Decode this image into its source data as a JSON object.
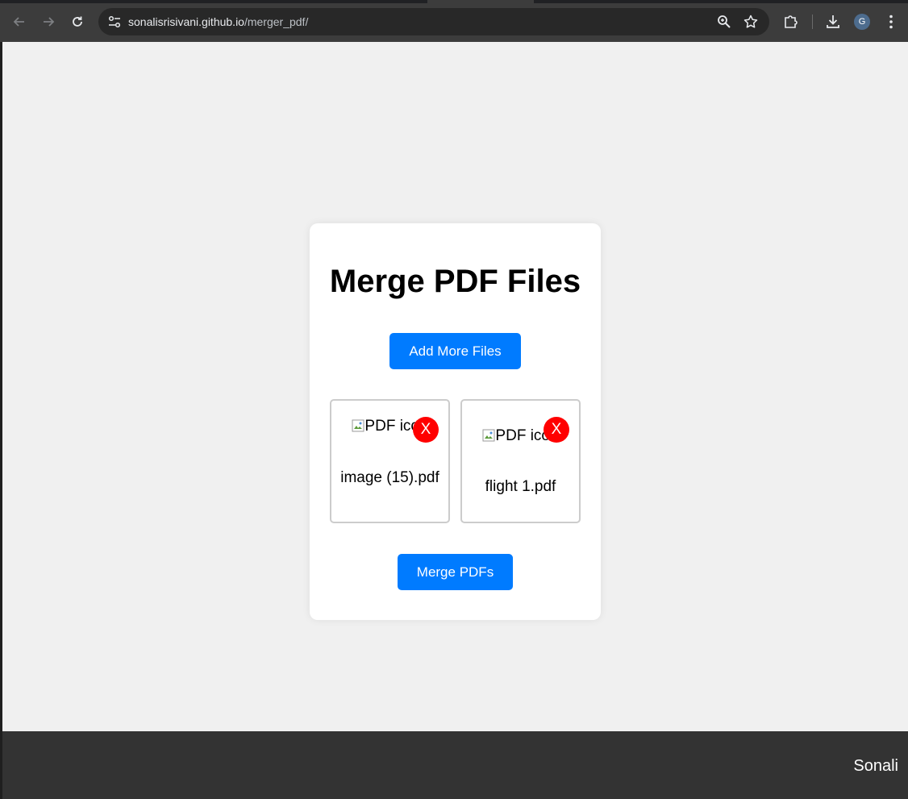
{
  "browser": {
    "url_host": "sonalisrisivani.github.io",
    "url_path": "/merger_pdf/",
    "profile_initial": "G"
  },
  "page": {
    "title": "Merge PDF Files",
    "add_button_label": "Add More Files",
    "merge_button_label": "Merge PDFs",
    "remove_label": "X",
    "files": [
      {
        "alt": "PDF icon",
        "name": "image (15).pdf"
      },
      {
        "alt": "PDF icon",
        "name": "flight 1.pdf"
      }
    ]
  },
  "footer": {
    "author": "Sonali"
  },
  "colors": {
    "primary": "#007bff",
    "remove": "#ff0000",
    "footer": "#333333",
    "background": "#f0f0f0"
  }
}
